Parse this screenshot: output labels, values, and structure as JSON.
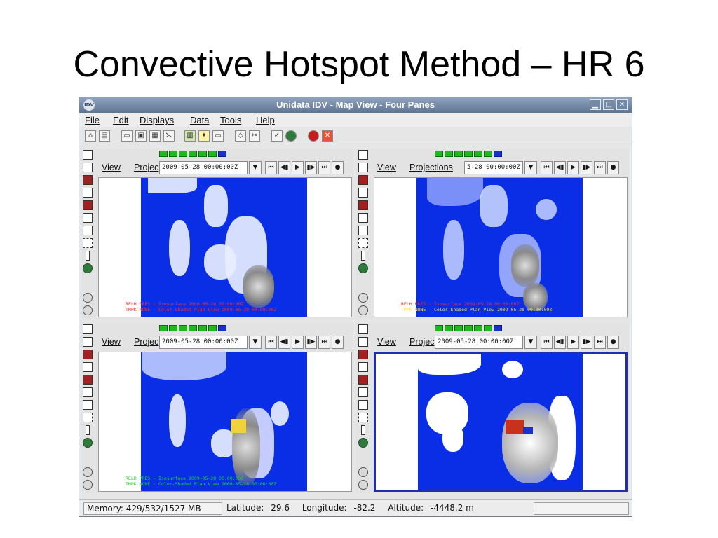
{
  "slide": {
    "title": "Convective Hotspot Method – HR 6"
  },
  "window": {
    "title": "Unidata IDV - Map View - Four Panes",
    "app_icon_text": "IDV",
    "controls": {
      "minimize": "▁",
      "maximize": "□",
      "close": "✕"
    }
  },
  "menu": [
    {
      "label": "File"
    },
    {
      "label": "Edit"
    },
    {
      "label": "Displays"
    },
    {
      "label": "Data"
    },
    {
      "label": "Tools"
    },
    {
      "label": "Help"
    }
  ],
  "toolbar_icons": [
    "home-icon",
    "new-view-icon",
    "open-icon",
    "save-icon",
    "save-as-icon",
    "scissors-small-icon",
    "data-chooser-icon",
    "lightbulb-icon",
    "window-icon",
    "eraser-icon",
    "cut-icon",
    "edit-check-icon",
    "globe-icon",
    "stop-icon",
    "close-icon"
  ],
  "panes": [
    {
      "view_label": "View",
      "projection_label": "Projec",
      "time": "2009-05-28 00:00:00Z",
      "legend": [
        "RELH PRES - Isosurface 2009-05-28 00:00:00Z",
        "TMPK NONE - Color-Shaded Plan View 2009-05-28 00:00:00Z"
      ],
      "legend_colors": [
        "#ff2a2a",
        "#ff2a2a"
      ]
    },
    {
      "view_label": "View",
      "projection_label": "Projections",
      "time": "5-28 00:00:00Z",
      "legend": [
        "RELH PRES - Isosurface 2009-05-28 00:00:00Z",
        "TMPK NONE - Color-Shaded Plan View 2009-05-28 00:00:00Z"
      ],
      "legend_colors": [
        "#ff2a2a",
        "#ffe23a"
      ]
    },
    {
      "view_label": "View",
      "projection_label": "Projec",
      "time": "2009-05-28 00:00:00Z",
      "legend": [
        "RELH PRES - Isosurface 2009-05-28 00:00:00Z",
        "TMPK NONE - Color-Shaded Plan View 2009-05-28 00:00:00Z"
      ],
      "legend_colors": [
        "#1fd41f",
        "#1fd41f"
      ]
    },
    {
      "view_label": "View",
      "projection_label": "Projec",
      "time": "2009-05-28 00:00:00Z",
      "legend": [],
      "legend_colors": []
    }
  ],
  "anim_controls": [
    "⏮",
    "◀▮",
    "▶",
    "▮▶",
    "⏭",
    "●"
  ],
  "status": {
    "memory": "Memory: 429/532/1527 MB",
    "latitude_label": "Latitude:",
    "latitude_value": "29.6",
    "longitude_label": "Longitude:",
    "longitude_value": "-82.2",
    "altitude_label": "Altitude:",
    "altitude_value": "-4448.2 m"
  },
  "colors": {
    "map_blue": "#0a2ee6",
    "selected_border": "#1f2fb0",
    "progress_green": "#1fb81f"
  }
}
